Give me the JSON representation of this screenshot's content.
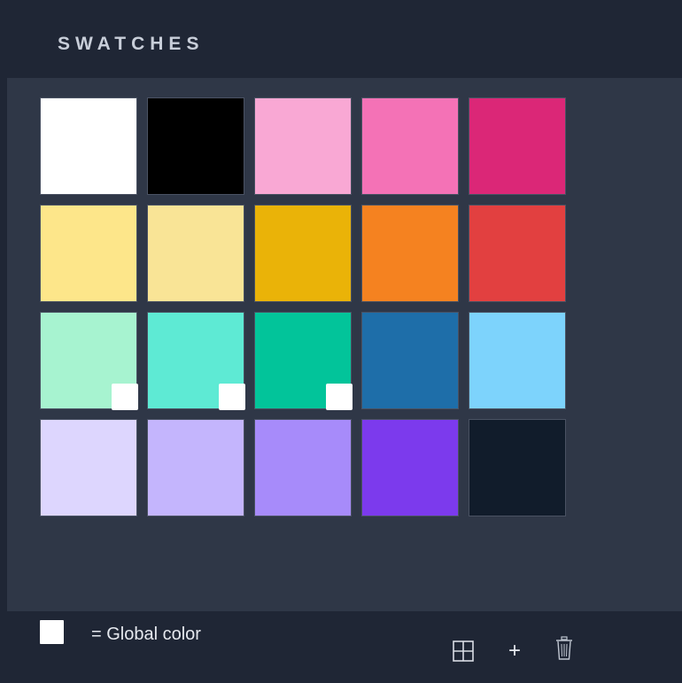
{
  "panel": {
    "title": "SWATCHES"
  },
  "swatches": [
    [
      {
        "color": "#ffffff",
        "global": false
      },
      {
        "color": "#000000",
        "global": false
      },
      {
        "color": "#f9a8d4",
        "global": false
      },
      {
        "color": "#f472b6",
        "global": false
      },
      {
        "color": "#db2777",
        "global": false
      }
    ],
    [
      {
        "color": "#fde68a",
        "global": false
      },
      {
        "color": "#f9e496",
        "global": false
      },
      {
        "color": "#eab308",
        "global": false
      },
      {
        "color": "#f58220",
        "global": false
      },
      {
        "color": "#e24040",
        "global": false
      }
    ],
    [
      {
        "color": "#a7f3d0",
        "global": true
      },
      {
        "color": "#5eead4",
        "global": true
      },
      {
        "color": "#02c49a",
        "global": true
      },
      {
        "color": "#1e6ea9",
        "global": false
      },
      {
        "color": "#7dd3fc",
        "global": false
      }
    ],
    [
      {
        "color": "#ddd6fe",
        "global": false
      },
      {
        "color": "#c4b5fd",
        "global": false
      },
      {
        "color": "#a78bfa",
        "global": false
      },
      {
        "color": "#7c3aed",
        "global": false
      },
      {
        "color": "#111c2b",
        "global": false
      }
    ]
  ],
  "legend": {
    "text": "= Global color",
    "marker_color": "#ffffff"
  },
  "toolbar": {
    "icons": [
      "grid-icon",
      "plus-icon",
      "trash-icon"
    ],
    "plus_label": "+"
  }
}
